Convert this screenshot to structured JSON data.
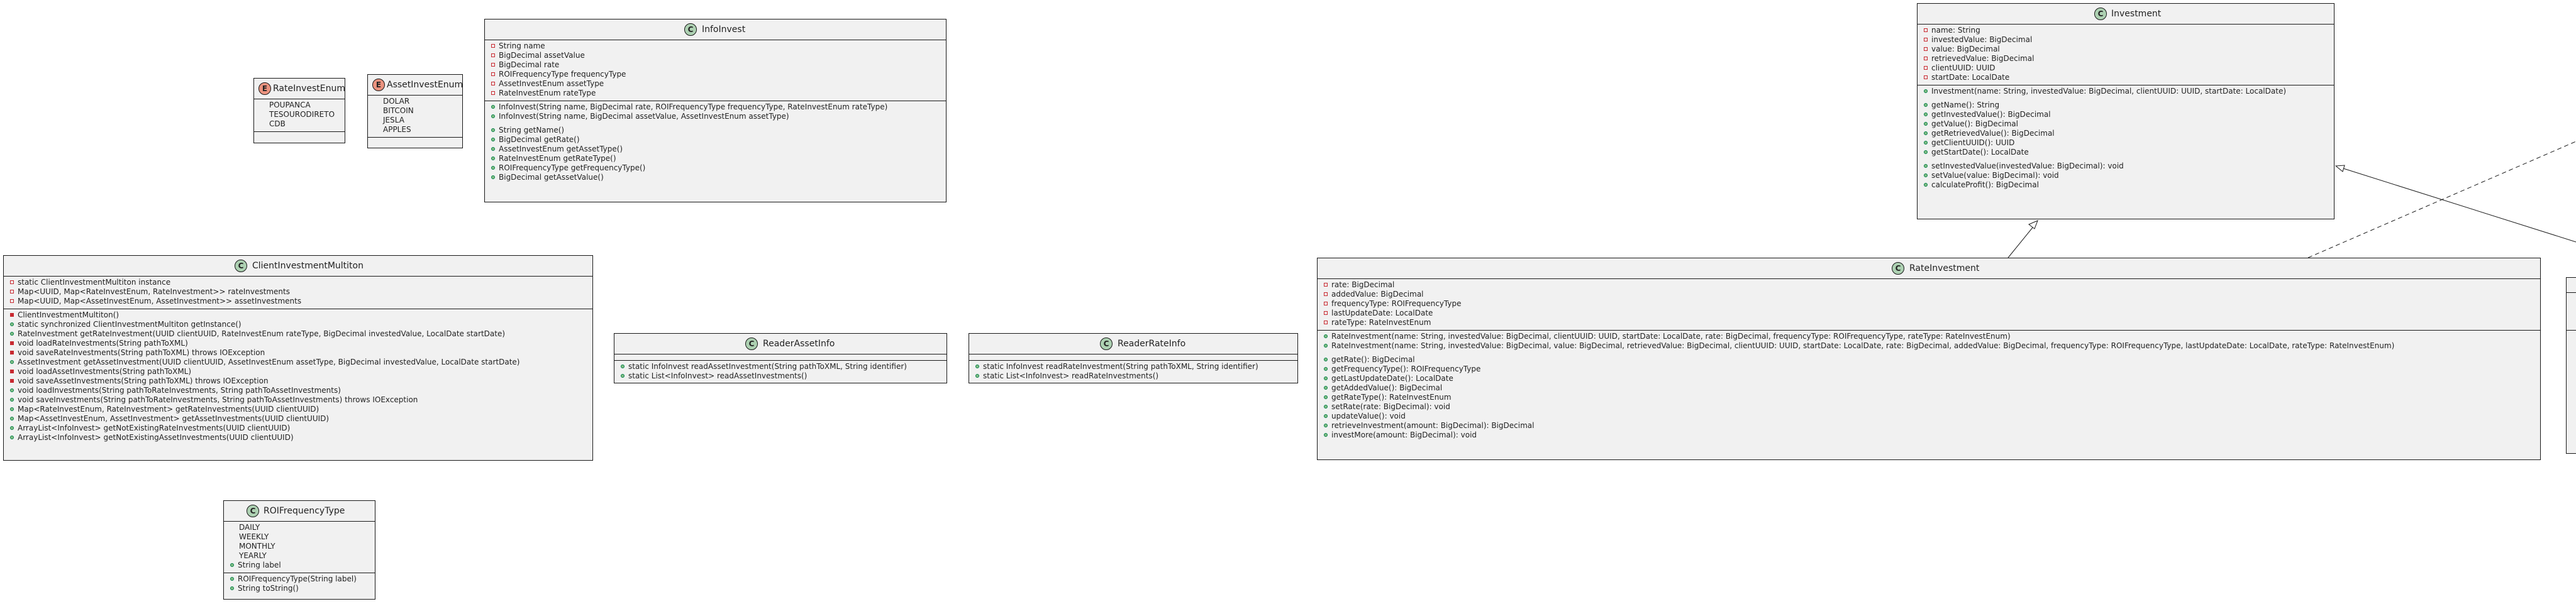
{
  "colors": {
    "class_fill": "#f1f1f1",
    "border": "#181818",
    "class_badge": "#add1b2",
    "enum_badge": "#eb937f",
    "private": "#c82930",
    "public": "#84be84"
  },
  "classes": {
    "rateinvestenum": {
      "kind": "E",
      "name": "RateInvestEnum",
      "sections": [
        [
          {
            "v": "",
            "t": "POUPANCA"
          },
          {
            "v": "",
            "t": "TESOURODIRETO"
          },
          {
            "v": "",
            "t": "CDB"
          }
        ],
        []
      ]
    },
    "assetinvestenum": {
      "kind": "E",
      "name": "AssetInvestEnum",
      "sections": [
        [
          {
            "v": "",
            "t": "DOLAR"
          },
          {
            "v": "",
            "t": "BITCOIN"
          },
          {
            "v": "",
            "t": "JESLA"
          },
          {
            "v": "",
            "t": "APPLES"
          }
        ],
        []
      ]
    },
    "infoinvest": {
      "kind": "C",
      "name": "InfoInvest",
      "sections": [
        [
          {
            "v": "priv",
            "t": "String name"
          },
          {
            "v": "priv",
            "t": "BigDecimal assetValue"
          },
          {
            "v": "priv",
            "t": "BigDecimal rate"
          },
          {
            "v": "priv",
            "t": "ROIFrequencyType frequencyType"
          },
          {
            "v": "priv",
            "t": "AssetInvestEnum assetType"
          },
          {
            "v": "priv",
            "t": "RateInvestEnum rateType"
          }
        ],
        [
          {
            "v": "pub",
            "t": "InfoInvest(String name, BigDecimal rate, ROIFrequencyType frequencyType, RateInvestEnum rateType)"
          },
          {
            "v": "pub",
            "t": "InfoInvest(String name, BigDecimal assetValue, AssetInvestEnum assetType)"
          },
          {
            "v": "pub",
            "t": "String getName()",
            "gap": true
          },
          {
            "v": "pub",
            "t": "BigDecimal getRate()"
          },
          {
            "v": "pub",
            "t": "AssetInvestEnum getAssetType()"
          },
          {
            "v": "pub",
            "t": "RateInvestEnum getRateType()"
          },
          {
            "v": "pub",
            "t": "ROIFrequencyType getFrequencyType()"
          },
          {
            "v": "pub",
            "t": "BigDecimal getAssetValue()"
          }
        ]
      ]
    },
    "investment": {
      "kind": "C",
      "name": "Investment",
      "sections": [
        [
          {
            "v": "priv",
            "t": "name: String"
          },
          {
            "v": "priv",
            "t": "investedValue: BigDecimal"
          },
          {
            "v": "priv",
            "t": "value: BigDecimal"
          },
          {
            "v": "priv",
            "t": "retrievedValue: BigDecimal"
          },
          {
            "v": "priv",
            "t": "clientUUID: UUID"
          },
          {
            "v": "priv",
            "t": "startDate: LocalDate"
          }
        ],
        [
          {
            "v": "pub",
            "t": "Investment(name: String, investedValue: BigDecimal, clientUUID: UUID, startDate: LocalDate)"
          },
          {
            "v": "pub",
            "t": "getName(): String",
            "gap": true
          },
          {
            "v": "pub",
            "t": "getInvestedValue(): BigDecimal"
          },
          {
            "v": "pub",
            "t": "getValue(): BigDecimal"
          },
          {
            "v": "pub",
            "t": "getRetrievedValue(): BigDecimal"
          },
          {
            "v": "pub",
            "t": "getClientUUID(): UUID"
          },
          {
            "v": "pub",
            "t": "getStartDate(): LocalDate"
          },
          {
            "v": "pub",
            "t": "setInvestedValue(investedValue: BigDecimal): void",
            "gap": true
          },
          {
            "v": "pub",
            "t": "setValue(value: BigDecimal): void"
          },
          {
            "v": "pub",
            "t": "calculateProfit(): BigDecimal"
          }
        ]
      ]
    },
    "clientmultiton": {
      "kind": "C",
      "name": "ClientInvestmentMultiton",
      "sections": [
        [
          {
            "v": "priv",
            "t": "static ClientInvestmentMultiton instance"
          },
          {
            "v": "priv",
            "t": "Map<UUID, Map<RateInvestEnum, RateInvestment>> rateInvestments"
          },
          {
            "v": "priv",
            "t": "Map<UUID, Map<AssetInvestEnum, AssetInvestment>> assetInvestments"
          }
        ],
        [
          {
            "v": "privm",
            "t": "ClientInvestmentMultiton()"
          },
          {
            "v": "pub",
            "t": "static synchronized ClientInvestmentMultiton getInstance()"
          },
          {
            "v": "pub",
            "t": "RateInvestment getRateInvestment(UUID clientUUID, RateInvestEnum rateType, BigDecimal investedValue, LocalDate startDate)"
          },
          {
            "v": "privm",
            "t": "void loadRateInvestments(String pathToXML)"
          },
          {
            "v": "privm",
            "t": "void saveRateInvestments(String pathToXML) throws IOException"
          },
          {
            "v": "pub",
            "t": "AssetInvestment getAssetInvestment(UUID clientUUID, AssetInvestEnum assetType, BigDecimal investedValue, LocalDate startDate)"
          },
          {
            "v": "privm",
            "t": "void loadAssetInvestments(String pathToXML)"
          },
          {
            "v": "privm",
            "t": "void saveAssetInvestments(String pathToXML) throws IOException"
          },
          {
            "v": "pub",
            "t": "void loadInvestments(String pathToRateInvestments, String pathToAssetInvestments)"
          },
          {
            "v": "pub",
            "t": "void saveInvestments(String pathToRateInvestments, String pathToAssetInvestments) throws IOException"
          },
          {
            "v": "pub",
            "t": "Map<RateInvestEnum, RateInvestment> getRateInvestments(UUID clientUUID)"
          },
          {
            "v": "pub",
            "t": "Map<AssetInvestEnum, AssetInvestment> getAssetInvestments(UUID clientUUID)"
          },
          {
            "v": "pub",
            "t": "ArrayList<InfoInvest> getNotExistingRateInvestments(UUID clientUUID)"
          },
          {
            "v": "pub",
            "t": "ArrayList<InfoInvest> getNotExistingAssetInvestments(UUID clientUUID)"
          }
        ]
      ]
    },
    "readerassetinfo": {
      "kind": "C",
      "name": "ReaderAssetInfo",
      "sections": [
        [],
        [
          {
            "v": "pub",
            "t": "static InfoInvest readAssetInvestment(String pathToXML, String identifier)"
          },
          {
            "v": "pub",
            "t": "static List<InfoInvest> readAssetInvestments()"
          }
        ]
      ]
    },
    "readerrateinfo": {
      "kind": "C",
      "name": "ReaderRateInfo",
      "sections": [
        [],
        [
          {
            "v": "pub",
            "t": "static InfoInvest readRateInvestment(String pathToXML, String identifier)"
          },
          {
            "v": "pub",
            "t": "static List<InfoInvest> readRateInvestments()"
          }
        ]
      ]
    },
    "rateinvestment": {
      "kind": "C",
      "name": "RateInvestment",
      "sections": [
        [
          {
            "v": "priv",
            "t": "rate: BigDecimal"
          },
          {
            "v": "priv",
            "t": "addedValue: BigDecimal"
          },
          {
            "v": "priv",
            "t": "frequencyType: ROIFrequencyType"
          },
          {
            "v": "priv",
            "t": "lastUpdateDate: LocalDate"
          },
          {
            "v": "priv",
            "t": "rateType: RateInvestEnum"
          }
        ],
        [
          {
            "v": "pub",
            "t": "RateInvestment(name: String, investedValue: BigDecimal, clientUUID: UUID, startDate: LocalDate, rate: BigDecimal, frequencyType: ROIFrequencyType, rateType: RateInvestEnum)"
          },
          {
            "v": "pub",
            "t": "RateInvestment(name: String, investedValue: BigDecimal, value: BigDecimal, retrievedValue: BigDecimal, clientUUID: UUID, startDate: LocalDate, rate: BigDecimal, addedValue: BigDecimal, frequencyType: ROIFrequencyType, lastUpdateDate: LocalDate, rateType: RateInvestEnum)"
          },
          {
            "v": "pub",
            "t": "getRate(): BigDecimal",
            "gap": true
          },
          {
            "v": "pub",
            "t": "getFrequencyType(): ROIFrequencyType"
          },
          {
            "v": "pub",
            "t": "getLastUpdateDate(): LocalDate"
          },
          {
            "v": "pub",
            "t": "getAddedValue(): BigDecimal"
          },
          {
            "v": "pub",
            "t": "getRateType(): RateInvestEnum"
          },
          {
            "v": "pub",
            "t": "setRate(rate: BigDecimal): void"
          },
          {
            "v": "pub",
            "t": "updateValue(): void"
          },
          {
            "v": "pub",
            "t": "retrieveInvestment(amount: BigDecimal): BigDecimal"
          },
          {
            "v": "pub",
            "t": "investMore(amount: BigDecimal): void"
          }
        ]
      ]
    },
    "roifrequencytype": {
      "kind": "C",
      "name": "ROIFrequencyType",
      "sections": [
        [
          {
            "v": "",
            "t": "DAILY"
          },
          {
            "v": "",
            "t": "WEEKLY"
          },
          {
            "v": "",
            "t": "MONTHLY"
          },
          {
            "v": "",
            "t": "YEARLY"
          },
          {
            "v": "pub",
            "t": "String label"
          }
        ],
        [
          {
            "v": "pub",
            "t": "ROIFrequencyType(String label)"
          },
          {
            "v": "pub",
            "t": "String toString()"
          }
        ]
      ]
    }
  }
}
